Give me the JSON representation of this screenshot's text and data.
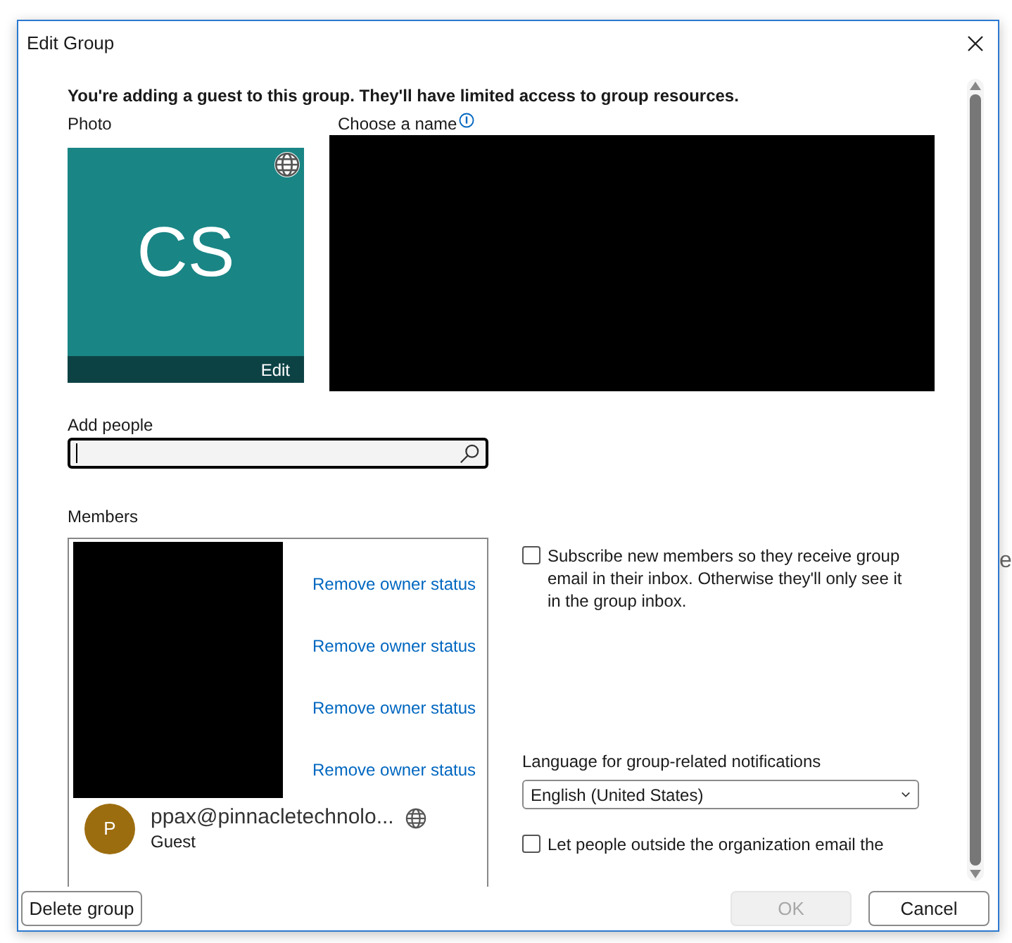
{
  "window": {
    "title": "Edit Group"
  },
  "notice": "You're adding a guest to this group. They'll have limited access to group resources.",
  "photo": {
    "label": "Photo",
    "initials": "CS",
    "edit": "Edit"
  },
  "name": {
    "label": "Choose a name"
  },
  "add_people": {
    "label": "Add people"
  },
  "members": {
    "label": "Members",
    "actions": [
      "Remove owner status",
      "Remove owner status",
      "Remove owner status",
      "Remove owner status"
    ],
    "items": [
      {
        "initial": "P",
        "name": "ppax@pinnacletechnolo...",
        "role": "Guest"
      }
    ]
  },
  "subscribe": {
    "label": "Subscribe new members so they receive group email in their inbox. Otherwise they'll only see it in the group inbox.",
    "checked": false
  },
  "language": {
    "label": "Language for group-related notifications",
    "value": "English (United States)"
  },
  "external_email": {
    "label": "Let people outside the organization email the",
    "checked": false
  },
  "buttons": [
    {
      "label": "Delete group",
      "disabled": false
    },
    {
      "label": "OK",
      "disabled": true
    },
    {
      "label": "Cancel",
      "disabled": false
    }
  ],
  "background_text": "e"
}
